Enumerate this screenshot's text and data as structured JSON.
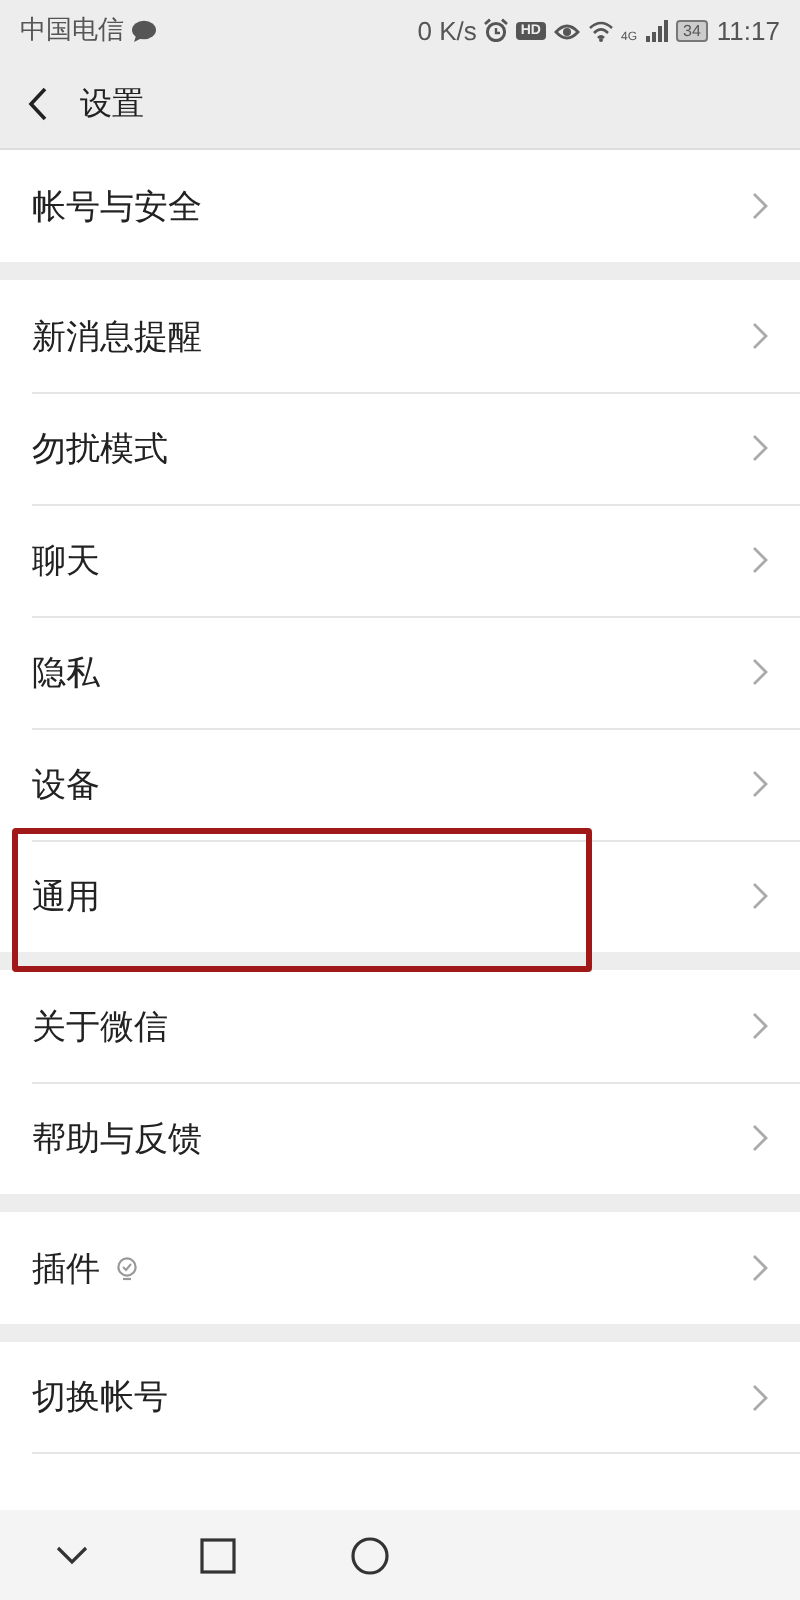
{
  "status_bar": {
    "carrier": "中国电信",
    "speed": "0 K/s",
    "hd_badge": "HD",
    "network": "4G",
    "battery": "34",
    "time": "11:17"
  },
  "header": {
    "title": "设置"
  },
  "groups": [
    {
      "items": [
        {
          "label": "帐号与安全"
        }
      ]
    },
    {
      "items": [
        {
          "label": "新消息提醒"
        },
        {
          "label": "勿扰模式"
        },
        {
          "label": "聊天"
        },
        {
          "label": "隐私"
        },
        {
          "label": "设备"
        },
        {
          "label": "通用",
          "highlighted": true
        }
      ]
    },
    {
      "items": [
        {
          "label": "关于微信"
        },
        {
          "label": "帮助与反馈"
        }
      ]
    },
    {
      "items": [
        {
          "label": "插件",
          "badge": true
        }
      ]
    },
    {
      "items": [
        {
          "label": "切换帐号"
        }
      ]
    }
  ]
}
